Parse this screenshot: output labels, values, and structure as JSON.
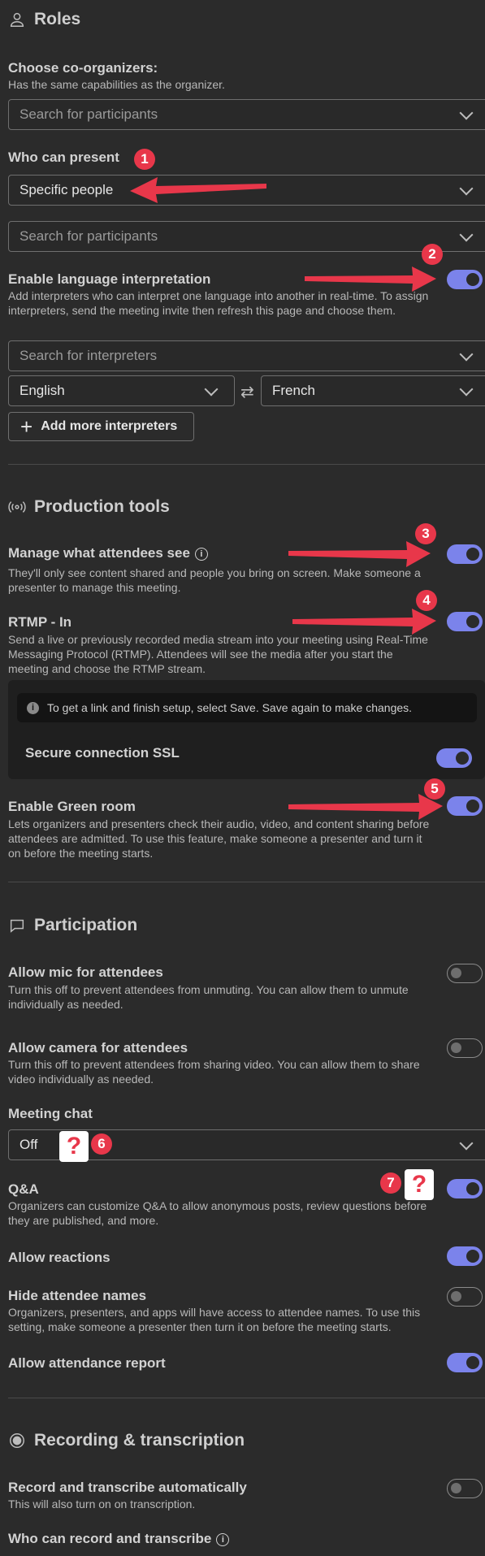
{
  "roles": {
    "heading": "Roles",
    "coorganizers_label": "Choose co-organizers:",
    "coorganizers_desc": "Has the same capabilities as the organizer.",
    "search_participants": "Search for participants",
    "who_can_present_label": "Who can present",
    "who_can_present_value": "Specific people",
    "search_participants_2": "Search for participants",
    "lang_interp_label": "Enable language interpretation",
    "lang_interp_desc": "Add interpreters who can interpret one language into another in real-time. To assign interpreters, send the meeting invite then refresh this page and choose them.",
    "search_interpreters": "Search for interpreters",
    "lang_from": "English",
    "lang_to": "French",
    "add_interpreters": "Add more interpreters"
  },
  "production": {
    "heading": "Production tools",
    "manage_label": "Manage what attendees see",
    "manage_desc": "They'll only see content shared and people you bring on screen. Make someone a presenter to manage this meeting.",
    "rtmp_label": "RTMP - In",
    "rtmp_desc": "Send a live or previously recorded media stream into your meeting using Real-Time Messaging Protocol (RTMP). Attendees will see the media after you start the meeting and choose the RTMP stream.",
    "rtmp_info": "To get a link and finish setup, select Save. Save again to make changes.",
    "ssl_label": "Secure connection SSL",
    "green_label": "Enable Green room",
    "green_desc": "Lets organizers and presenters check their audio, video, and content sharing before attendees are admitted. To use this feature, make someone a presenter and turn it on before the meeting starts."
  },
  "participation": {
    "heading": "Participation",
    "mic_label": "Allow mic for attendees",
    "mic_desc": "Turn this off to prevent attendees from unmuting. You can allow them to unmute individually as needed.",
    "camera_label": "Allow camera for attendees",
    "camera_desc": "Turn this off to prevent attendees from sharing video. You can allow them to share video individually as needed.",
    "chat_label": "Meeting chat",
    "chat_value": "Off",
    "qa_label": "Q&A",
    "qa_desc": "Organizers can customize Q&A to allow anonymous posts, review questions before they are published, and more.",
    "reactions_label": "Allow reactions",
    "hide_names_label": "Hide attendee names",
    "hide_names_desc": "Organizers, presenters, and apps will have access to attendee names. To use this setting, make someone a presenter then turn it on before the meeting starts.",
    "attendance_label": "Allow attendance report"
  },
  "recording": {
    "heading": "Recording & transcription",
    "auto_label": "Record and transcribe automatically",
    "auto_desc": "This will also turn on on transcription.",
    "who_label": "Who can record and transcribe"
  },
  "toggles": {
    "lang_interp": true,
    "manage": true,
    "rtmp": true,
    "ssl": true,
    "green": true,
    "mic": false,
    "camera": false,
    "qa": true,
    "reactions": true,
    "hide_names": false,
    "attendance": true,
    "auto_record": false
  },
  "annotations": {
    "badges": [
      "1",
      "2",
      "3",
      "4",
      "5",
      "6",
      "7"
    ],
    "question": "?",
    "accent_color": "#e8374a",
    "toggle_color": "#7b83eb"
  }
}
